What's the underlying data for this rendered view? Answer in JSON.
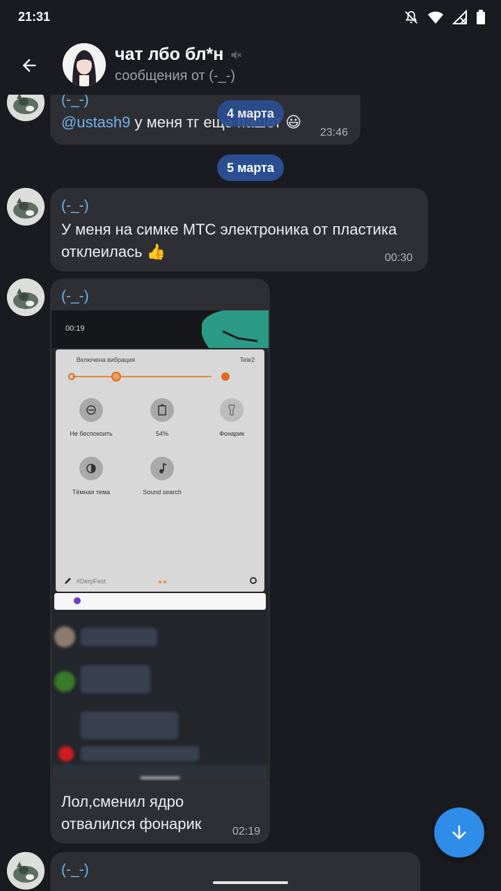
{
  "status_bar": {
    "time": "21:31"
  },
  "header": {
    "title": "чат лбо бл*н",
    "subtitle": "сообщения от (-_-)"
  },
  "dates": {
    "first": "4 марта",
    "second": "5 марта"
  },
  "messages": [
    {
      "sender": "(-_-)",
      "mention": "@ustash9",
      "text": " у меня тг еще пашет 😃",
      "time": "23:46"
    },
    {
      "sender": "(-_-)",
      "text_line1": "У меня на симке МТС электроника от пластика",
      "text_line2": "отклеилась 👍",
      "time": "00:30"
    },
    {
      "sender": "(-_-)",
      "text_line1": "Лол,сменил ядро",
      "text_line2": "отвалился фонарик",
      "time": "02:19"
    },
    {
      "sender": "(-_-)"
    }
  ],
  "screenshot": {
    "time": "00:19",
    "vibration": "Включена вибрация",
    "carrier": "Tele2",
    "tile_dnd": "Не беспокоить",
    "tile_battery": "54%",
    "tile_flashlight": "Фонарик",
    "tile_dark": "Тёмная тема",
    "tile_sound": "Sound search",
    "footer_tag": "#DerpFest"
  },
  "colors": {
    "accent": "#2f8ce8",
    "date_pill": "#2b4e92",
    "bubble": "#2e2f34",
    "sender": "#6fb3ee"
  }
}
